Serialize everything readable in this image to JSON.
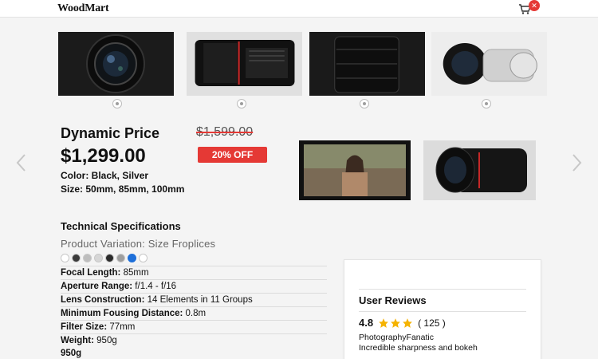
{
  "header": {
    "logo": "WoodMart",
    "cart_icon": "cart-icon",
    "cart_badge": "✕"
  },
  "thumbnails": [
    {
      "name": "lens-front-view",
      "active": true
    },
    {
      "name": "lens-side-view",
      "active": false
    },
    {
      "name": "lens-top-view",
      "active": false
    },
    {
      "name": "lens-pair-view",
      "active": false
    }
  ],
  "product": {
    "title": "Dynamic Price",
    "old_price": "$1,599.00",
    "price": "$1,299.00",
    "discount_badge": "20% OFF",
    "color": "Color: Black, Silver",
    "size": "Size: 50mm, 85mm, 100mm"
  },
  "specs": {
    "heading": "Technical Specifications",
    "variation": "Product Variation: Size Froplices",
    "swatch_colors": [
      "#ffffff",
      "#3a3a3a",
      "#bdbdbd",
      "#d6d6d6",
      "#2b2b2b",
      "#9e9e9e",
      "#1e6fd9",
      "#ffffff"
    ],
    "rows": [
      {
        "label": "Focal Length:",
        "value": " 85mm"
      },
      {
        "label": "Aperture Range:",
        "value": " f/1.4 - f/16"
      },
      {
        "label": "Lens Construction:",
        "value": " 14 Elements in 11 Groups"
      },
      {
        "label": "Minimum Fousing Distance:",
        "value": " 0.8m"
      },
      {
        "label": "Filter Size:",
        "value": " 77mm"
      },
      {
        "label": "Weight:",
        "value": " 950g"
      }
    ],
    "extra": "950g"
  },
  "reviews": {
    "title": "User Reviews",
    "rating": "4.8",
    "stars": 3,
    "count": "( 125 )",
    "user": "PhotographyFanatic",
    "text": "Incredible sharpness and bokeh"
  }
}
